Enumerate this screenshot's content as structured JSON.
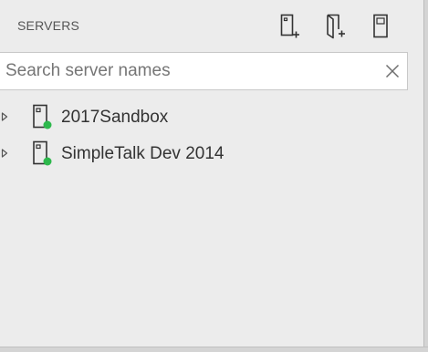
{
  "panel": {
    "title": "SERVERS",
    "toolbar": [
      {
        "name": "new-connection-button",
        "icon": "server-add-icon"
      },
      {
        "name": "new-server-group-button",
        "icon": "server-group-add-icon"
      },
      {
        "name": "active-connections-button",
        "icon": "server-icon"
      }
    ]
  },
  "search": {
    "placeholder": "Search server names",
    "value": "",
    "clear_icon": "close-icon"
  },
  "servers": [
    {
      "name": "2017Sandbox",
      "status": "connected",
      "status_color": "#2db84c",
      "expanded": false
    },
    {
      "name": "SimpleTalk Dev 2014",
      "status": "connected",
      "status_color": "#2db84c",
      "expanded": false
    }
  ],
  "colors": {
    "panel_background": "#ececec",
    "status_connected": "#2db84c",
    "icon_stroke": "#333333"
  }
}
